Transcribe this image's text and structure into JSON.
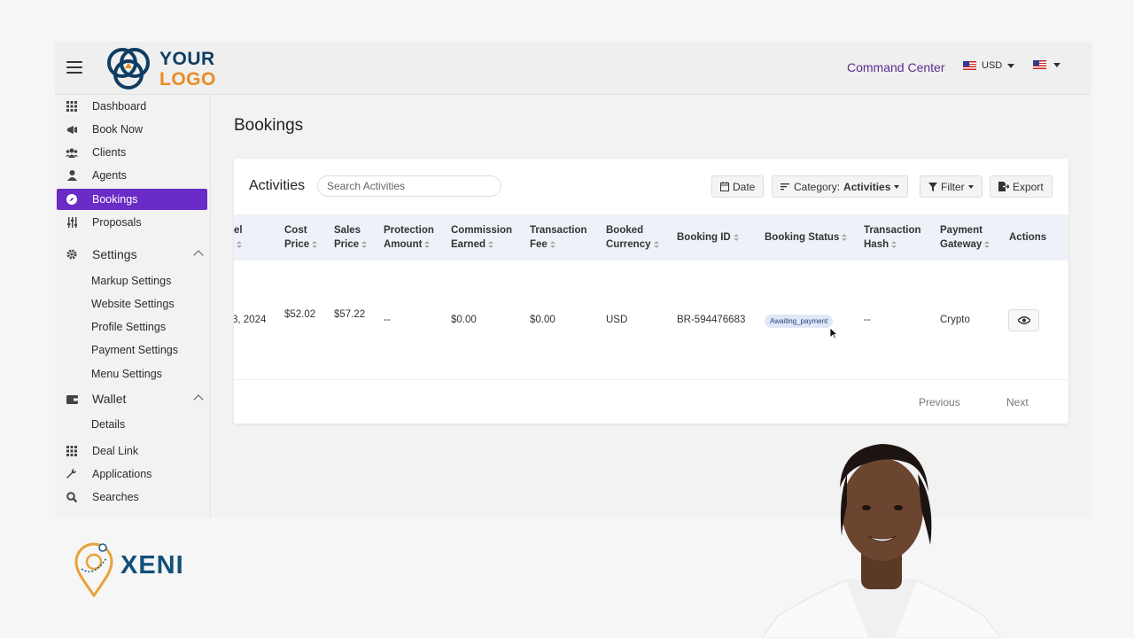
{
  "header": {
    "logo_line1": "YOUR",
    "logo_line2": "LOGO",
    "command_center": "Command Center",
    "currency": "USD"
  },
  "sidebar": {
    "items": [
      {
        "label": "Dashboard",
        "icon": "grid-icon"
      },
      {
        "label": "Book Now",
        "icon": "megaphone-icon"
      },
      {
        "label": "Clients",
        "icon": "users-icon"
      },
      {
        "label": "Agents",
        "icon": "user-icon"
      },
      {
        "label": "Bookings",
        "icon": "compass-icon",
        "active": true
      },
      {
        "label": "Proposals",
        "icon": "sliders-icon"
      }
    ],
    "settings": {
      "label": "Settings",
      "sub": [
        "Markup Settings",
        "Website Settings",
        "Profile Settings",
        "Payment Settings",
        "Menu Settings"
      ]
    },
    "wallet": {
      "label": "Wallet",
      "sub": [
        "Details"
      ]
    },
    "bottom_items": [
      {
        "label": "Deal Link",
        "icon": "grid-icon"
      },
      {
        "label": "Applications",
        "icon": "wrench-icon"
      },
      {
        "label": "Searches",
        "icon": "search-icon"
      }
    ]
  },
  "page": {
    "title": "Bookings"
  },
  "card": {
    "title": "Activities",
    "search_placeholder": "Search Activities",
    "date_btn": "Date",
    "category_prefix": "Category:",
    "category_value": "Activities",
    "filter_btn": "Filter",
    "export_btn": "Export"
  },
  "table": {
    "columns": [
      [
        "el",
        ""
      ],
      [
        "Cost",
        "Price"
      ],
      [
        "Sales",
        "Price"
      ],
      [
        "Protection",
        "Amount"
      ],
      [
        "Commission",
        "Earned"
      ],
      [
        "Transaction",
        "Fee"
      ],
      [
        "Booked",
        "Currency"
      ],
      [
        "Booking ID",
        ""
      ],
      [
        "Booking Status",
        ""
      ],
      [
        "Transaction",
        "Hash"
      ],
      [
        "Payment",
        "Gateway"
      ],
      [
        "Actions",
        ""
      ]
    ],
    "row": {
      "date": "3, 2024",
      "cost_price": "$52.02",
      "sales_price": "$57.22",
      "protection": "--",
      "commission": "$0.00",
      "fee": "$0.00",
      "currency": "USD",
      "booking_id": "BR-594476683",
      "status": "Awaiting_payment",
      "hash": "--",
      "gateway": "Crypto"
    }
  },
  "pager": {
    "previous": "Previous",
    "next": "Next"
  },
  "watermark": {
    "brand": "XENI"
  },
  "colors": {
    "accent": "#6a2bc6",
    "logo_blue": "#0f3d63",
    "logo_orange": "#e88c22"
  }
}
